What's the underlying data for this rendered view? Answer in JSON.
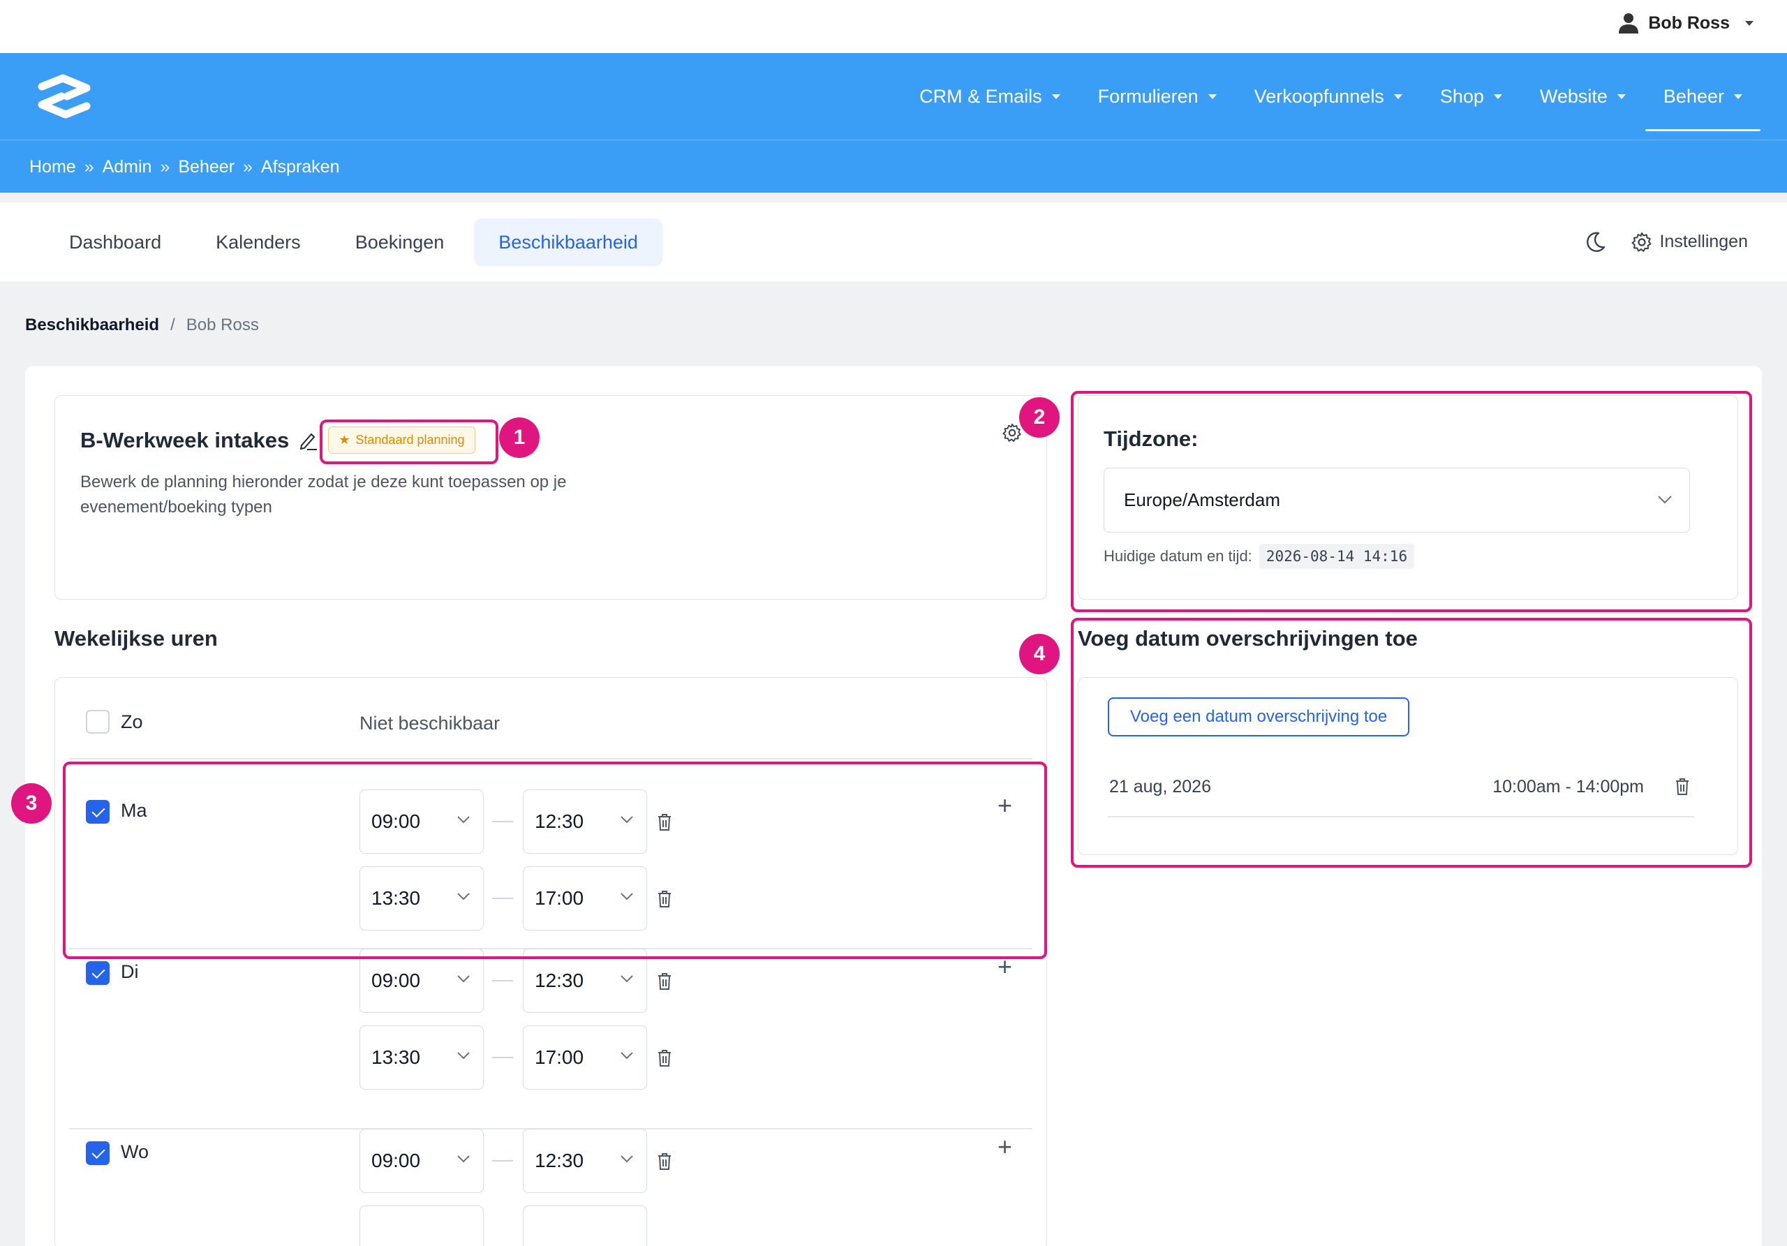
{
  "user": {
    "name": "Bob Ross"
  },
  "nav": {
    "items": [
      {
        "label": "CRM & Emails"
      },
      {
        "label": "Formulieren"
      },
      {
        "label": "Verkoopfunnels"
      },
      {
        "label": "Shop"
      },
      {
        "label": "Website"
      },
      {
        "label": "Beheer"
      }
    ],
    "active": "Beheer"
  },
  "breadcrumb": {
    "items": [
      "Home",
      "Admin",
      "Beheer",
      "Afspraken"
    ],
    "separator": "»"
  },
  "tabs": {
    "items": [
      {
        "label": "Dashboard"
      },
      {
        "label": "Kalenders"
      },
      {
        "label": "Boekingen"
      },
      {
        "label": "Beschikbaarheid"
      }
    ],
    "active": "Beschikbaarheid",
    "settings_label": "Instellingen"
  },
  "page_crumb": {
    "section": "Beschikbaarheid",
    "separator": "/",
    "user": "Bob Ross"
  },
  "schedule": {
    "title": "B-Werkweek intakes",
    "badge": "Standaard planning",
    "description": "Bewerk de planning hieronder zodat je deze kunt toepassen op je evenement/boeking typen"
  },
  "weekly": {
    "title": "Wekelijkse uren",
    "unavailable_label": "Niet beschikbaar",
    "days": [
      {
        "label": "Zo",
        "checked": false,
        "slots": []
      },
      {
        "label": "Ma",
        "checked": true,
        "slots": [
          {
            "from": "09:00",
            "to": "12:30"
          },
          {
            "from": "13:30",
            "to": "17:00"
          }
        ]
      },
      {
        "label": "Di",
        "checked": true,
        "slots": [
          {
            "from": "09:00",
            "to": "12:30"
          },
          {
            "from": "13:30",
            "to": "17:00"
          }
        ]
      },
      {
        "label": "Wo",
        "checked": true,
        "slots": [
          {
            "from": "09:00",
            "to": "12:30"
          }
        ]
      }
    ]
  },
  "timezone": {
    "title": "Tijdzone:",
    "value": "Europe/Amsterdam",
    "current_label": "Huidige datum en tijd:",
    "current_value": "2026-08-14 14:16"
  },
  "overrides": {
    "title": "Voeg datum overschrijvingen toe",
    "add_button": "Voeg een datum overschrijving toe",
    "items": [
      {
        "date": "21 aug, 2026",
        "hours": "10:00am - 14:00pm"
      }
    ]
  },
  "annotations": [
    "1",
    "2",
    "3",
    "4"
  ],
  "colors": {
    "brand_blue": "#3a9ef7",
    "accent_blue": "#2563eb",
    "highlight": "#e0157f",
    "badge_orange": "#e08a00"
  }
}
